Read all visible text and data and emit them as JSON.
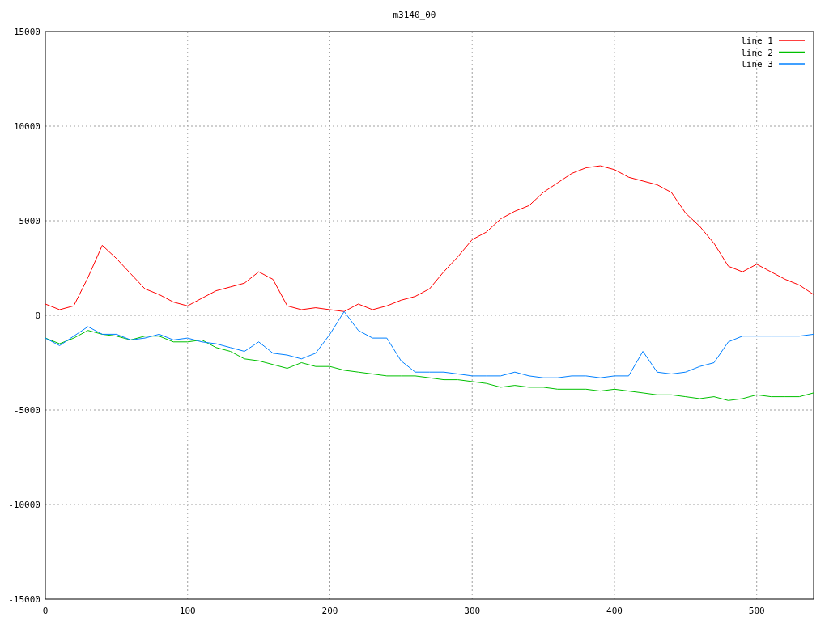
{
  "chart_data": {
    "type": "line",
    "title": "m3140_00",
    "x": [
      0,
      10,
      20,
      30,
      40,
      50,
      60,
      70,
      80,
      90,
      100,
      110,
      120,
      130,
      140,
      150,
      160,
      170,
      180,
      190,
      200,
      210,
      220,
      230,
      240,
      250,
      260,
      270,
      280,
      290,
      300,
      310,
      320,
      330,
      340,
      350,
      360,
      370,
      380,
      390,
      400,
      410,
      420,
      430,
      440,
      450,
      460,
      470,
      480,
      490,
      500,
      510,
      520,
      530,
      540
    ],
    "series": [
      {
        "name": "line 1",
        "color": "#ff0000",
        "values": [
          600,
          300,
          500,
          2000,
          3700,
          3000,
          2200,
          1400,
          1100,
          700,
          500,
          900,
          1300,
          1500,
          1700,
          2300,
          1900,
          500,
          300,
          400,
          300,
          200,
          600,
          300,
          500,
          800,
          1000,
          1400,
          2300,
          3100,
          4000,
          4400,
          5100,
          5500,
          5800,
          6500,
          7000,
          7500,
          7800,
          7900,
          7700,
          7300,
          7100,
          6900,
          6500,
          5400,
          4700,
          3800,
          2600,
          2300,
          2700,
          2300,
          1900,
          1600,
          1100
        ]
      },
      {
        "name": "line 2",
        "color": "#00c000",
        "values": [
          -1200,
          -1500,
          -1200,
          -800,
          -1000,
          -1100,
          -1300,
          -1100,
          -1100,
          -1400,
          -1400,
          -1300,
          -1700,
          -1900,
          -2300,
          -2400,
          -2600,
          -2800,
          -2500,
          -2700,
          -2700,
          -2900,
          -3000,
          -3100,
          -3200,
          -3200,
          -3200,
          -3300,
          -3400,
          -3400,
          -3500,
          -3600,
          -3800,
          -3700,
          -3800,
          -3800,
          -3900,
          -3900,
          -3900,
          -4000,
          -3900,
          -4000,
          -4100,
          -4200,
          -4200,
          -4300,
          -4400,
          -4300,
          -4500,
          -4400,
          -4200,
          -4300,
          -4300,
          -4300,
          -4100
        ]
      },
      {
        "name": "line 3",
        "color": "#0080ff",
        "values": [
          -1200,
          -1600,
          -1100,
          -600,
          -1000,
          -1000,
          -1300,
          -1200,
          -1000,
          -1300,
          -1200,
          -1400,
          -1500,
          -1700,
          -1900,
          -1400,
          -2000,
          -2100,
          -2300,
          -2000,
          -1000,
          200,
          -800,
          -1200,
          -1200,
          -2400,
          -3000,
          -3000,
          -3000,
          -3100,
          -3200,
          -3200,
          -3200,
          -3000,
          -3200,
          -3300,
          -3300,
          -3200,
          -3200,
          -3300,
          -3200,
          -3200,
          -1900,
          -3000,
          -3100,
          -3000,
          -2700,
          -2500,
          -1400,
          -1100,
          -1100,
          -1100,
          -1100,
          -1100,
          -1000
        ]
      }
    ],
    "xlim": [
      0,
      540
    ],
    "ylim": [
      -15000,
      15000
    ],
    "xticks": [
      0,
      100,
      200,
      300,
      400,
      500
    ],
    "yticks": [
      -15000,
      -10000,
      -5000,
      0,
      5000,
      10000,
      15000
    ],
    "grid": true,
    "legend": true
  }
}
